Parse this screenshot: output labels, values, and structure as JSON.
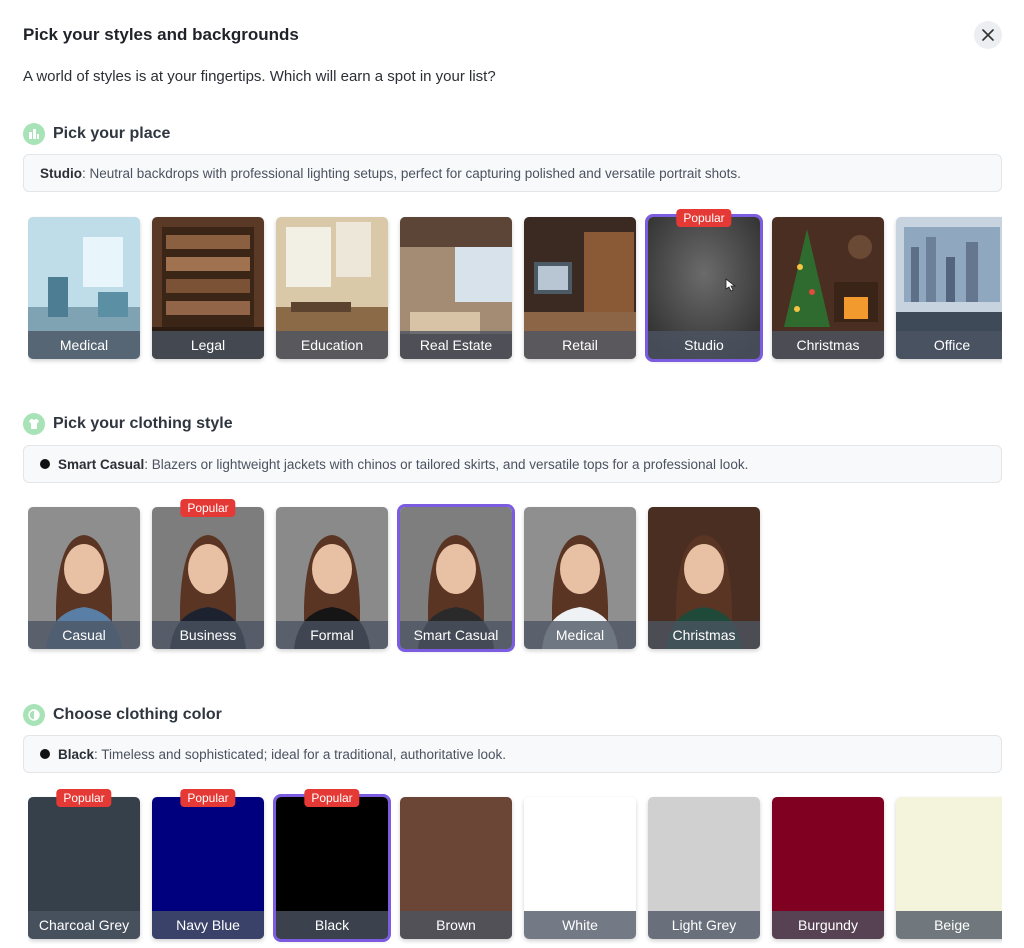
{
  "header": {
    "title": "Pick your styles and backgrounds"
  },
  "subtitle": "A world of styles is at your fingertips. Which will earn a spot in your list?",
  "popular_label": "Popular",
  "place": {
    "title": "Pick your place",
    "selected_name": "Studio",
    "selected_desc": ": Neutral backdrops with professional lighting setups, perfect for capturing polished and versatile portrait shots.",
    "items": [
      {
        "label": "Medical",
        "popular": false,
        "selected": false
      },
      {
        "label": "Legal",
        "popular": false,
        "selected": false
      },
      {
        "label": "Education",
        "popular": false,
        "selected": false
      },
      {
        "label": "Real Estate",
        "popular": false,
        "selected": false
      },
      {
        "label": "Retail",
        "popular": false,
        "selected": false
      },
      {
        "label": "Studio",
        "popular": true,
        "selected": true
      },
      {
        "label": "Christmas",
        "popular": false,
        "selected": false
      },
      {
        "label": "Office",
        "popular": false,
        "selected": false
      }
    ]
  },
  "clothing": {
    "title": "Pick your clothing style",
    "selected_name": "Smart Casual",
    "selected_desc": ": Blazers or lightweight jackets with chinos or tailored skirts, and versatile tops for a professional look.",
    "items": [
      {
        "label": "Casual",
        "popular": false,
        "selected": false
      },
      {
        "label": "Business",
        "popular": true,
        "selected": false
      },
      {
        "label": "Formal",
        "popular": false,
        "selected": false
      },
      {
        "label": "Smart Casual",
        "popular": false,
        "selected": true
      },
      {
        "label": "Medical",
        "popular": false,
        "selected": false
      },
      {
        "label": "Christmas",
        "popular": false,
        "selected": false
      }
    ]
  },
  "color": {
    "title": "Choose clothing color",
    "selected_name": "Black",
    "selected_desc": ": Timeless and sophisticated; ideal for a traditional, authoritative look.",
    "items": [
      {
        "label": "Charcoal Grey",
        "hex": "#36404a",
        "popular": true,
        "selected": false
      },
      {
        "label": "Navy Blue",
        "hex": "#00007f",
        "popular": true,
        "selected": false
      },
      {
        "label": "Black",
        "hex": "#000000",
        "popular": true,
        "selected": true
      },
      {
        "label": "Brown",
        "hex": "#6b4535",
        "popular": false,
        "selected": false
      },
      {
        "label": "White",
        "hex": "#ffffff",
        "popular": false,
        "selected": false
      },
      {
        "label": "Light Grey",
        "hex": "#d0d0d0",
        "popular": false,
        "selected": false
      },
      {
        "label": "Burgundy",
        "hex": "#7f0020",
        "popular": false,
        "selected": false
      },
      {
        "label": "Beige",
        "hex": "#f4f4dc",
        "popular": false,
        "selected": false
      }
    ]
  },
  "colors": {
    "accent": "#7c5ce0",
    "popular_badge": "#e53935",
    "section_icon": "#a7e3b6"
  }
}
